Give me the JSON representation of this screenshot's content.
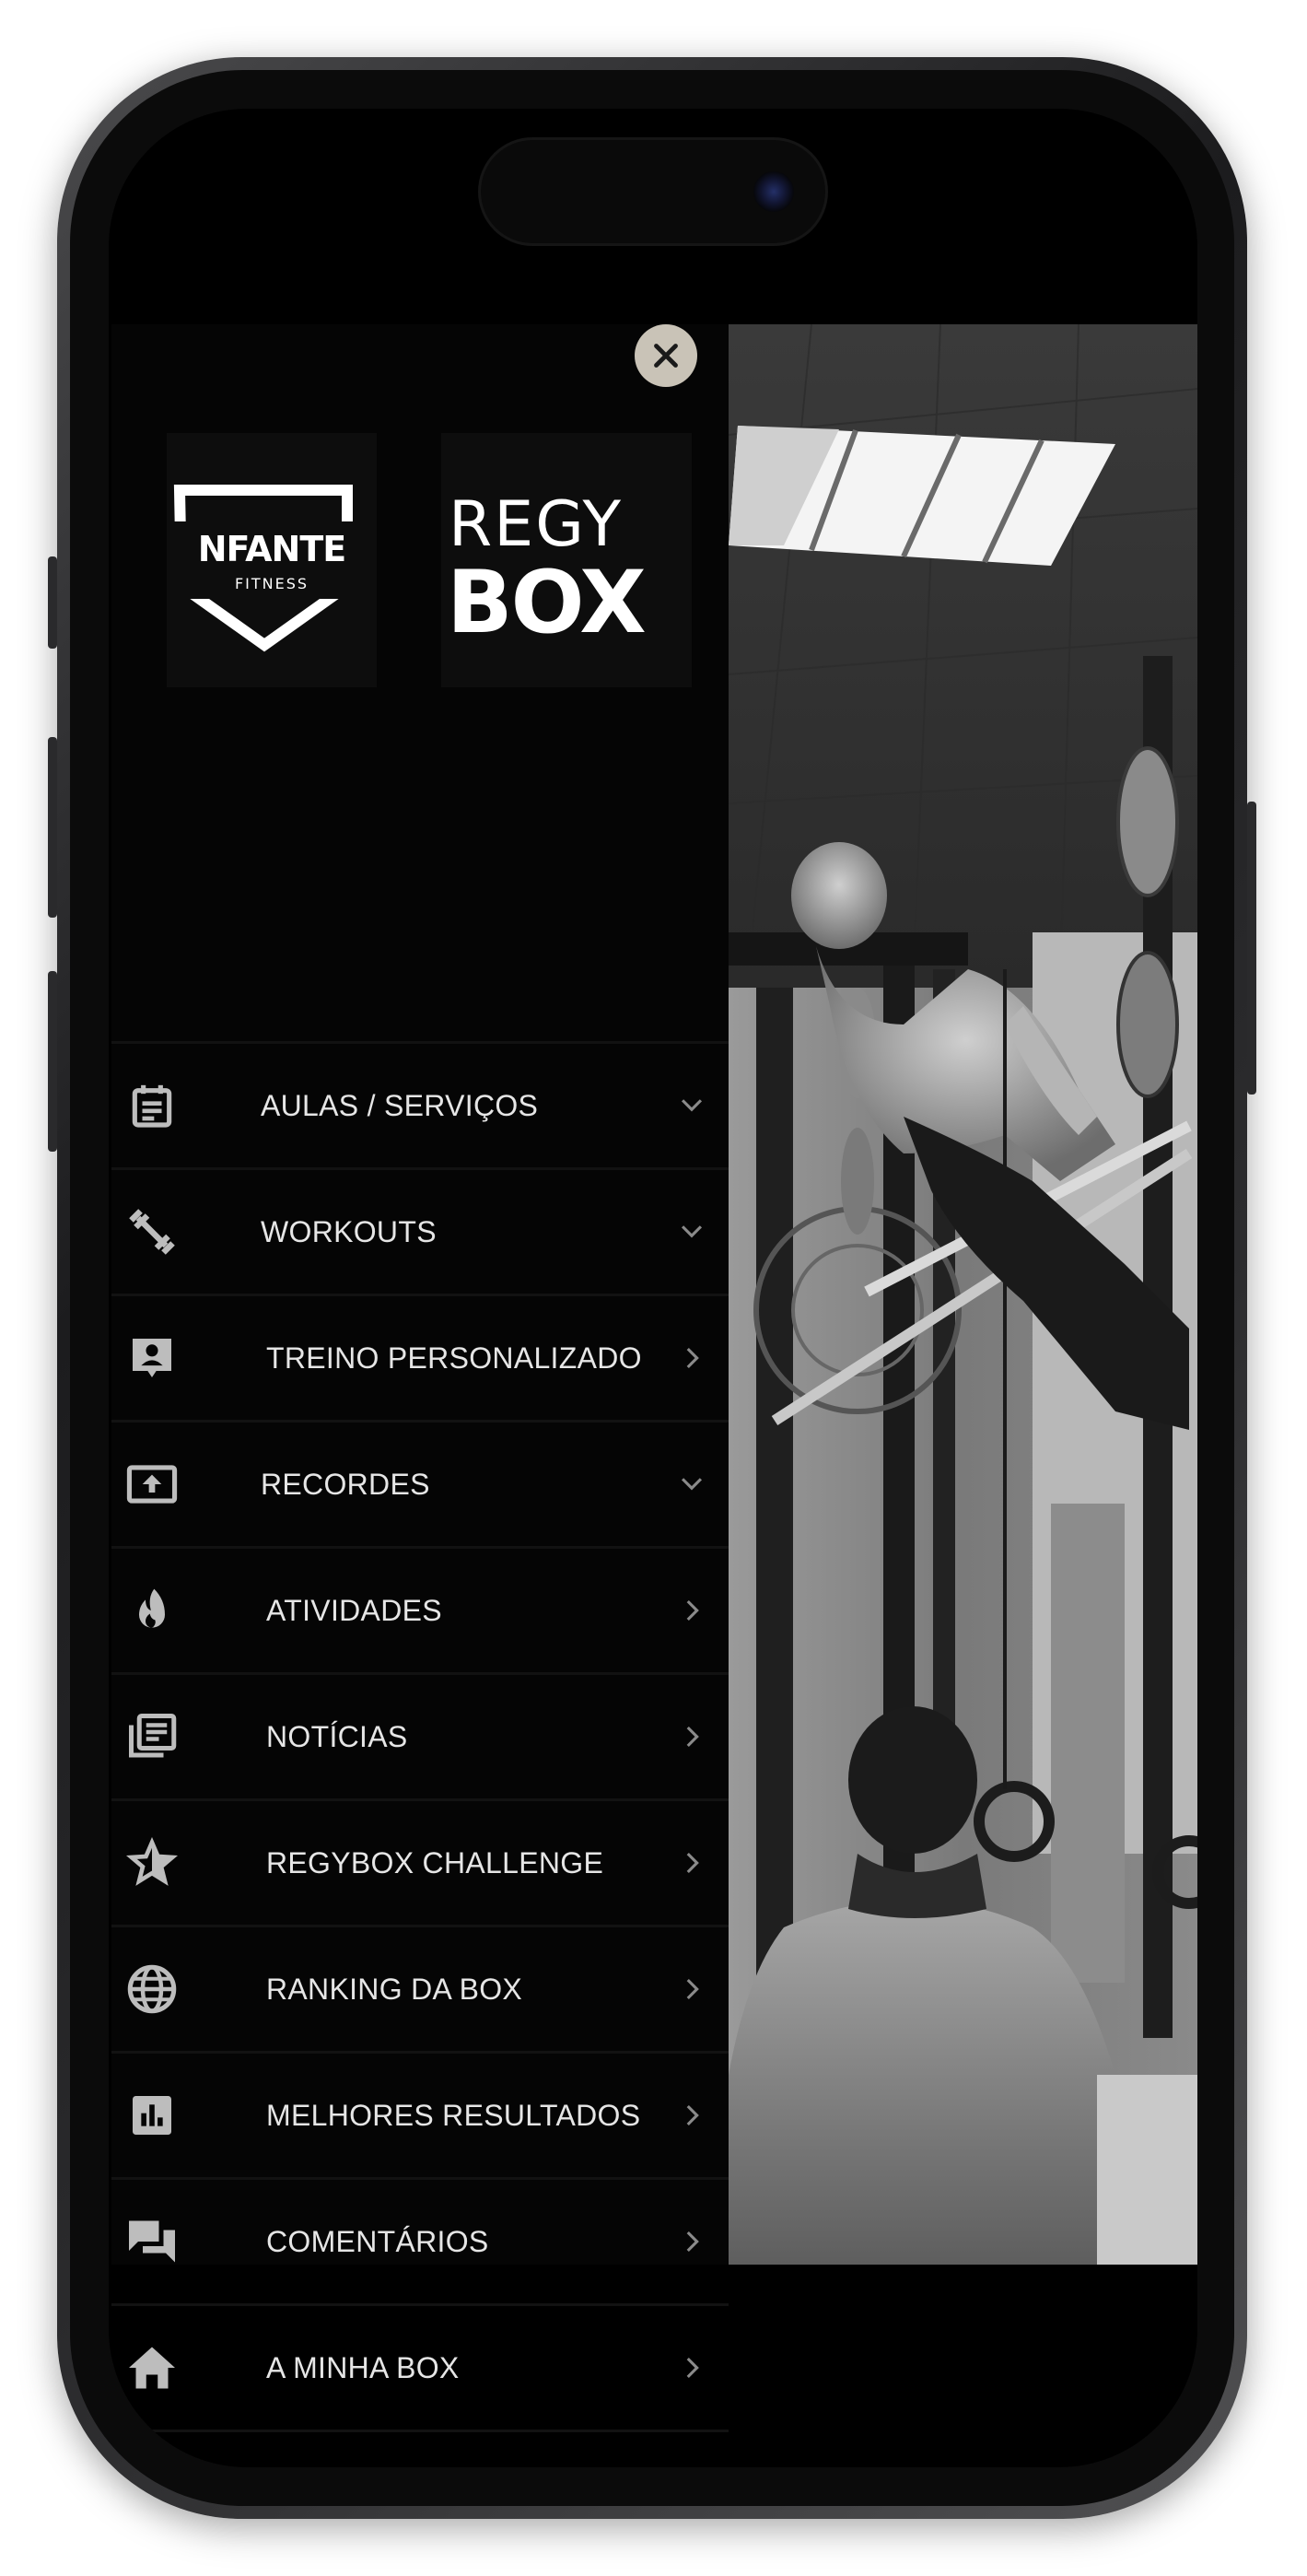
{
  "drawer": {
    "close_icon": "close-icon",
    "logos": {
      "partner": {
        "title": "NFANTE",
        "subtitle": "FITNESS"
      },
      "app": {
        "line1": "REGY",
        "line2": "BOX"
      }
    },
    "items": [
      {
        "label": "AULAS / SERVIÇOS",
        "icon": "calendar-icon",
        "chevron": "down"
      },
      {
        "label": "WORKOUTS",
        "icon": "dumbbell-icon",
        "chevron": "down"
      },
      {
        "label": "TREINO PERSONALIZADO",
        "icon": "personal-trainer-icon",
        "chevron": "right"
      },
      {
        "label": "RECORDES",
        "icon": "upload-record-icon",
        "chevron": "down"
      },
      {
        "label": "ATIVIDADES",
        "icon": "flame-icon",
        "chevron": "right"
      },
      {
        "label": "NOTÍCIAS",
        "icon": "news-icon",
        "chevron": "right"
      },
      {
        "label": "REGYBOX CHALLENGE",
        "icon": "star-icon",
        "chevron": "right"
      },
      {
        "label": "RANKING DA BOX",
        "icon": "globe-icon",
        "chevron": "right"
      },
      {
        "label": "MELHORES RESULTADOS",
        "icon": "bar-chart-icon",
        "chevron": "right"
      },
      {
        "label": "COMENTÁRIOS",
        "icon": "chat-icon",
        "chevron": "right"
      },
      {
        "label": "A MINHA BOX",
        "icon": "home-icon",
        "chevron": "right"
      }
    ]
  },
  "colors": {
    "drawer_bg": "#050505",
    "text": "#e6e6e6",
    "icon": "#bdbdbd",
    "close_bg": "#c9c3b7"
  }
}
